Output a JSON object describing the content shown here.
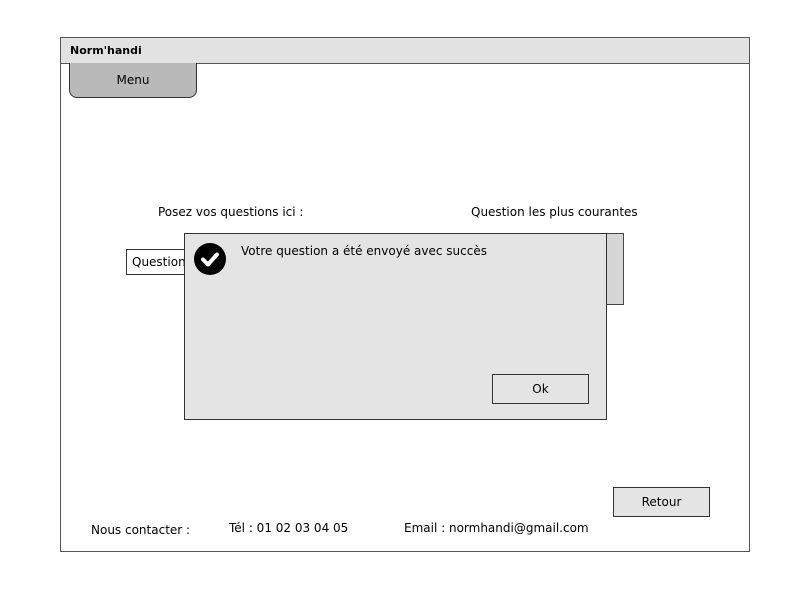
{
  "window": {
    "title": "Norm'handi"
  },
  "nav": {
    "menu_label": "Menu"
  },
  "main": {
    "questions_label": "Posez vos questions ici :",
    "question_field_value": "Question",
    "popular_label": "Question les plus courantes"
  },
  "dialog": {
    "icon": "check-circle-icon",
    "message": "Votre question a été envoyé avec succès",
    "ok_label": "Ok"
  },
  "actions": {
    "retour_label": "Retour"
  },
  "footer": {
    "contact_label": "Nous contacter :",
    "tel": "Tél : 01 02 03 04 05",
    "email": "Email : normhandi@gmail.com"
  }
}
